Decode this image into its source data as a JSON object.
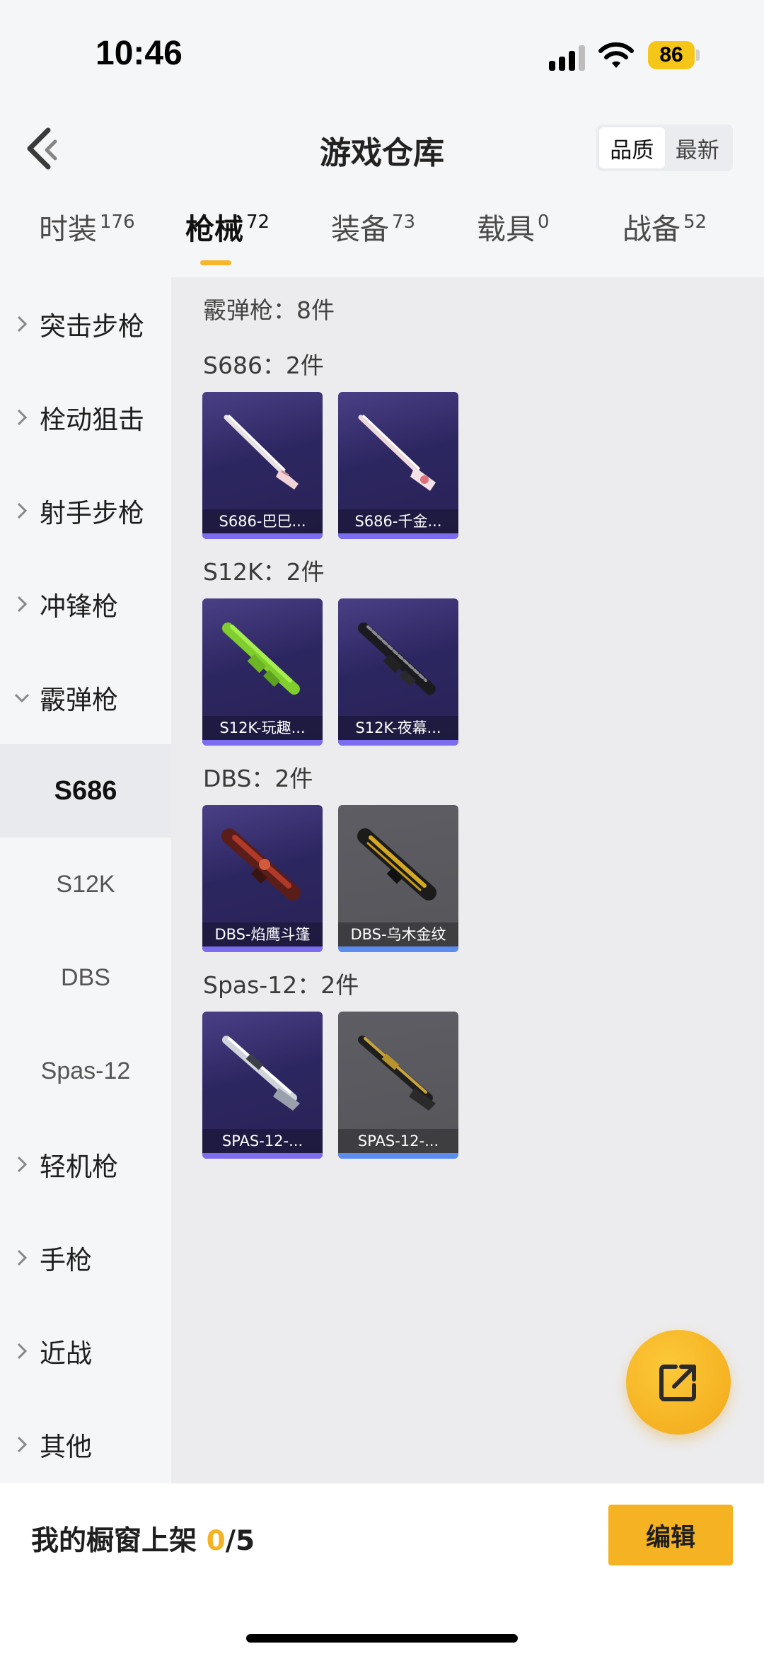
{
  "status_bar": {
    "time": "10:46",
    "battery": "86"
  },
  "header": {
    "title": "游戏仓库",
    "sort_options": [
      "品质",
      "最新"
    ],
    "active_sort": "品质"
  },
  "tabs": [
    {
      "label": "时装",
      "count": "176"
    },
    {
      "label": "枪械",
      "count": "72",
      "active": true
    },
    {
      "label": "装备",
      "count": "73"
    },
    {
      "label": "载具",
      "count": "0"
    },
    {
      "label": "战备",
      "count": "52"
    }
  ],
  "sidebar": {
    "categories": [
      "突击步枪",
      "栓动狙击",
      "射手步枪",
      "冲锋枪",
      "霰弹枪"
    ],
    "subcategories": [
      "S686",
      "S12K",
      "DBS",
      "Spas-12"
    ],
    "active_subcategory": "S686",
    "more_categories": [
      "轻机枪",
      "手枪",
      "近战",
      "其他"
    ]
  },
  "content": {
    "summary": "霰弹枪：8件",
    "groups": [
      {
        "title": "S686：2件",
        "items": [
          {
            "name": "S686-巴巳...",
            "bg": "purple",
            "icon": "double-barrel-shotgun-white"
          },
          {
            "name": "S686-千金...",
            "bg": "purple",
            "icon": "double-barrel-shotgun-pink"
          }
        ]
      },
      {
        "title": "S12K：2件",
        "items": [
          {
            "name": "S12K-玩趣...",
            "bg": "purple",
            "icon": "shotgun-green"
          },
          {
            "name": "S12K-夜幕...",
            "bg": "purple",
            "icon": "shotgun-dark"
          }
        ]
      },
      {
        "title": "DBS：2件",
        "items": [
          {
            "name": "DBS-焰鹰斗篷",
            "bg": "purple",
            "icon": "bullpup-shotgun-red"
          },
          {
            "name": "DBS-乌木金纹",
            "bg": "gray",
            "icon": "bullpup-shotgun-gold"
          }
        ]
      },
      {
        "title": "Spas-12：2件",
        "items": [
          {
            "name": "SPAS-12-...",
            "bg": "purple",
            "icon": "pump-shotgun-silver"
          },
          {
            "name": "SPAS-12-...",
            "bg": "gray",
            "icon": "pump-shotgun-gold"
          }
        ]
      }
    ]
  },
  "bottom_bar": {
    "showcase_label": "我的橱窗上架",
    "showcase_current": "0",
    "showcase_total": "/5",
    "edit_label": "编辑"
  },
  "colors": {
    "accent": "#f5b222",
    "purple_card": "#2c2660",
    "gray_card": "#58585d"
  }
}
